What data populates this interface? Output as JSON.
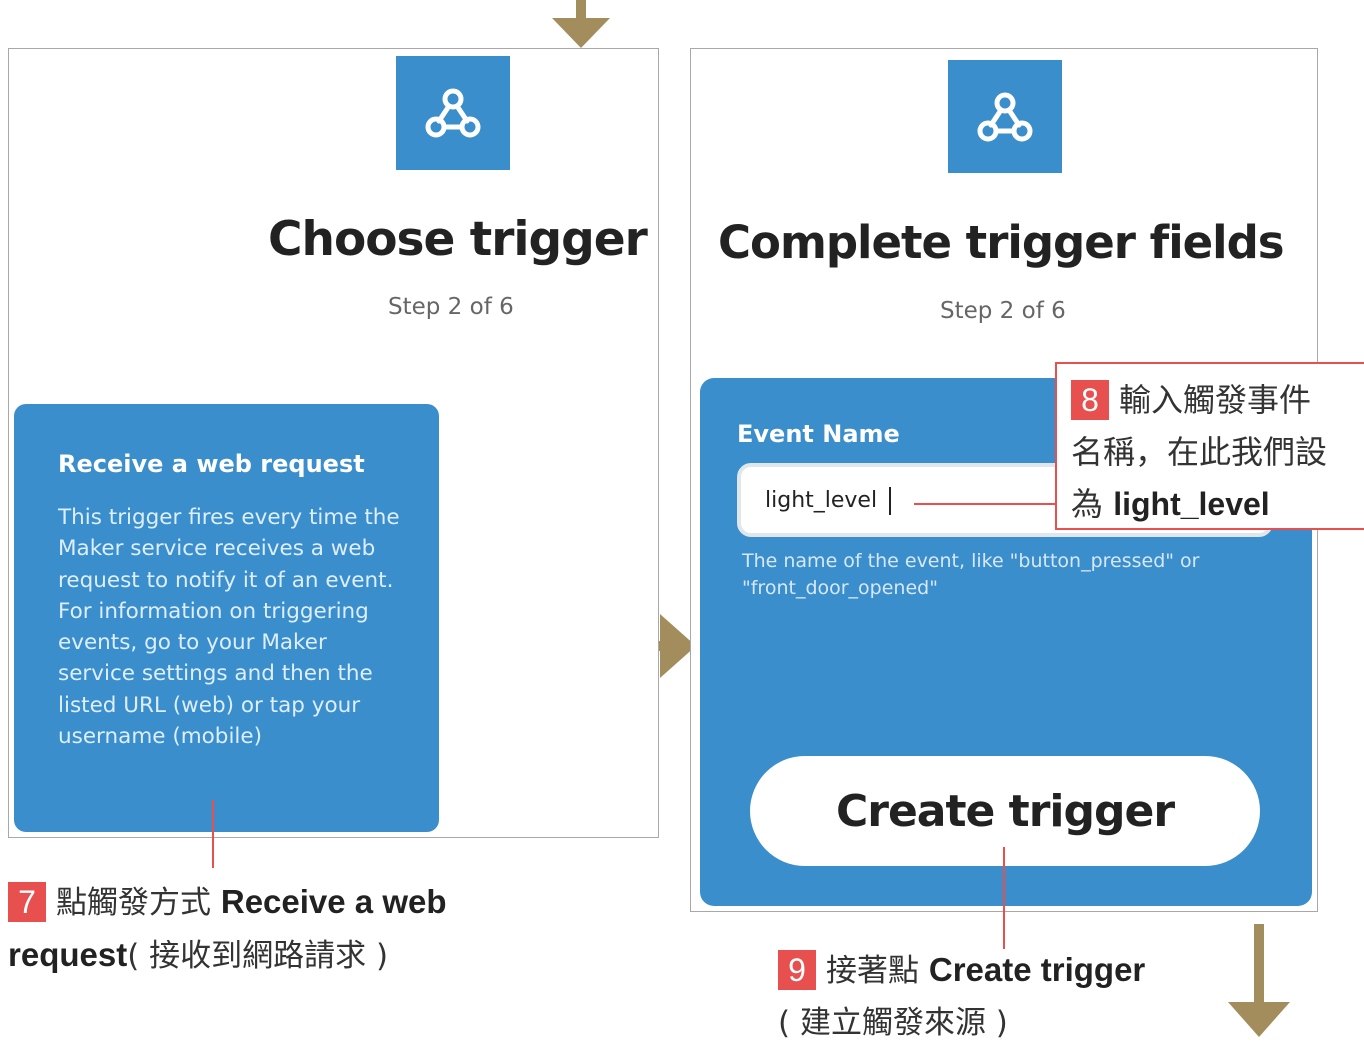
{
  "colors": {
    "accent_blue": "#3b8ecc",
    "callout_red": "#e8504f",
    "arrow_gold": "#a38d5d"
  },
  "screen_1": {
    "logo_icon": "webhook-icon",
    "title": "Choose trigger",
    "step": "Step 2 of 6",
    "trigger_card": {
      "title": "Receive a web request",
      "description": "This trigger fires every time the Maker service receives a web request to notify it of an event. For information on triggering events, go to your Maker service settings and then the listed URL (web) or tap your username (mobile)"
    }
  },
  "screen_2": {
    "logo_icon": "webhook-icon",
    "title": "Complete trigger fields",
    "step": "Step 2 of 6",
    "field": {
      "label": "Event Name",
      "value": "light_level",
      "hint": "The name of the event, like \"button_pressed\" or \"front_door_opened\""
    },
    "create_button": "Create trigger"
  },
  "callouts": {
    "c7": {
      "number": "7",
      "text_pre": "點觸發方式 ",
      "text_bold_1": "Receive a web",
      "text_bold_2": "request",
      "text_post": "( 接收到網路請求 )"
    },
    "c8": {
      "number": "8",
      "line1": "輸入觸發事件",
      "line2": "名稱，在此我們設",
      "line3_pre": "為 ",
      "line3_bold": "light_level"
    },
    "c9": {
      "number": "9",
      "text_pre": "接著點 ",
      "text_bold": "Create trigger",
      "text_line2": "( 建立觸發來源 )"
    }
  }
}
